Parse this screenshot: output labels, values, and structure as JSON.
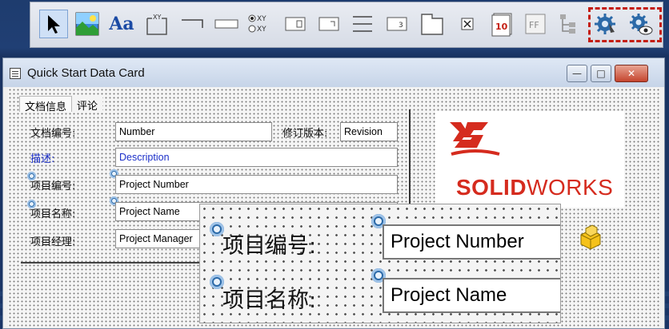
{
  "toolbar": {
    "tools": [
      {
        "name": "select-tool",
        "icon": "arrow-pointer-icon",
        "active": true
      },
      {
        "name": "image-tool",
        "icon": "picture-icon"
      },
      {
        "name": "label-tool",
        "icon": "text-aa-icon",
        "text": "Aa"
      },
      {
        "name": "group-box-tool",
        "icon": "group-box-icon",
        "text": "XY"
      },
      {
        "name": "line-tool",
        "icon": "line-icon"
      },
      {
        "name": "edit-box-tool",
        "icon": "edit-box-icon"
      },
      {
        "name": "radio-tool",
        "icon": "radio-button-icon",
        "text": "XY"
      },
      {
        "name": "list-tool",
        "icon": "list-box-icon"
      },
      {
        "name": "combo-tool",
        "icon": "combo-box-icon"
      },
      {
        "name": "separator-tool",
        "icon": "separator-icon"
      },
      {
        "name": "numeric-tool",
        "icon": "numeric-box-icon",
        "text": "3"
      },
      {
        "name": "tab-tool",
        "icon": "tab-control-icon"
      },
      {
        "name": "checkbox-tool",
        "icon": "checkbox-icon"
      },
      {
        "name": "date-tool",
        "icon": "calendar-icon",
        "text": "10"
      },
      {
        "name": "frame-tool",
        "icon": "frame-icon",
        "text": "FF"
      },
      {
        "name": "tree-tool",
        "icon": "tree-icon"
      },
      {
        "name": "properties-tool",
        "icon": "gear-properties-icon"
      },
      {
        "name": "preview-tool",
        "icon": "gear-preview-icon"
      }
    ]
  },
  "window": {
    "title": "Quick Start Data Card",
    "controls": {
      "minimize": "—",
      "maximize": "□",
      "close": "✕"
    }
  },
  "tabs": [
    "文档信息",
    "评论"
  ],
  "form": {
    "doc_number_label": "文档编号:",
    "doc_number_value": "Number",
    "revision_label": "修订版本:",
    "revision_value": "Revision",
    "description_label": "描述:",
    "description_value": "Description",
    "project_number_label": "项目编号:",
    "project_number_value": "Project Number",
    "project_name_label": "项目名称:",
    "project_name_value": "Project Name",
    "project_manager_label": "项目经理:",
    "project_manager_value": "Project Manager"
  },
  "logo": {
    "brand_bold": "SOLID",
    "brand_thin": "WORKS"
  },
  "zoom": {
    "project_number_label": "项目编号:",
    "project_number_value": "Project Number",
    "project_name_label": "项目名称:",
    "project_name_value": "Project Name"
  },
  "colors": {
    "highlight": "#c41d12",
    "brand": "#d52b1e",
    "label_blue": "#1b2fc9"
  }
}
